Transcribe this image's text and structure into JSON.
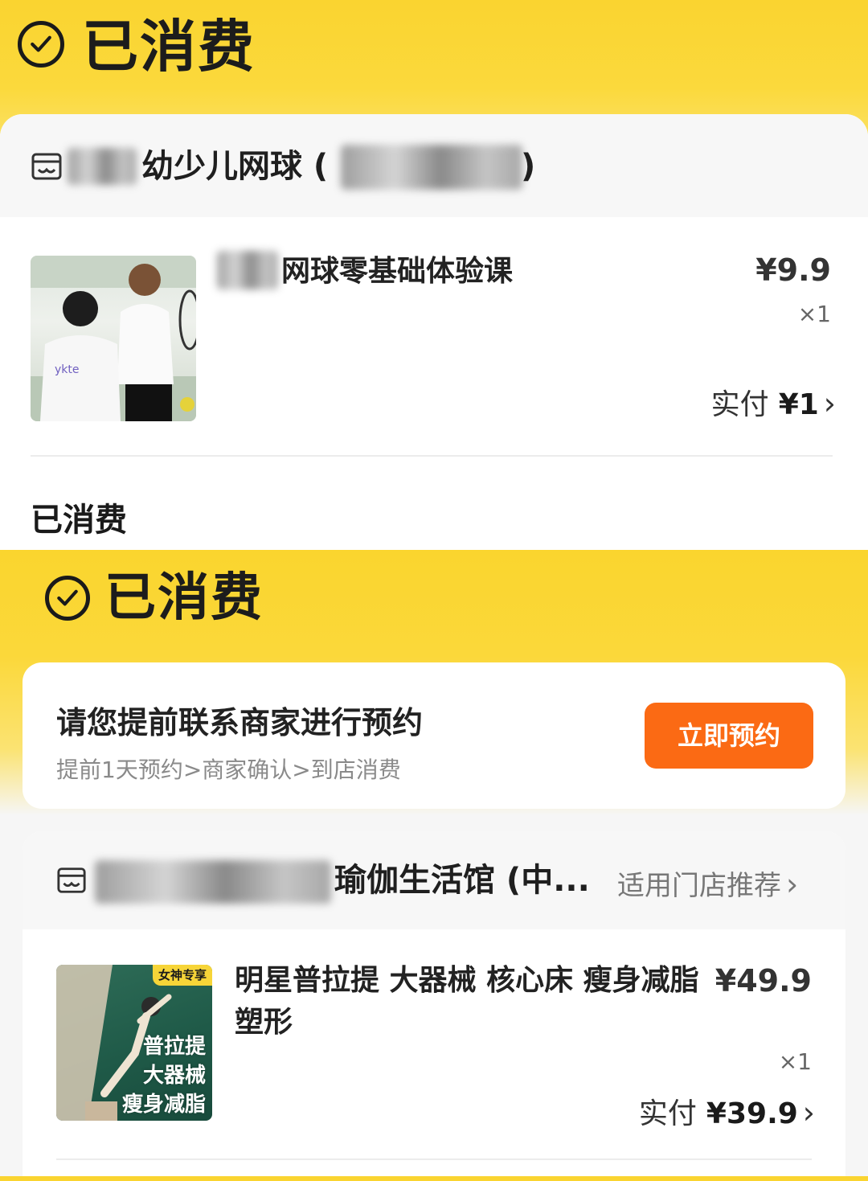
{
  "section1": {
    "status_title": "已消费",
    "store_name": "幼少儿网球 (",
    "store_name_close": ")",
    "product": {
      "title": "网球零基础体验课",
      "price": "¥9.9",
      "qty": "×1",
      "paid_label": "实付",
      "paid_amount": "¥1"
    },
    "caption": "已消费"
  },
  "section2": {
    "status_title": "已消费",
    "reserve": {
      "title": "请您提前联系商家进行预约",
      "subtitle": "提前1天预约>商家确认>到店消费",
      "button": "立即预约"
    },
    "store_name": "瑜伽生活馆 (中...",
    "store_recommend": "适用门店推荐",
    "product": {
      "title_line1": "明星普拉提 大器械 核心床 瘦身减脂",
      "title_line2": "塑形",
      "price": "¥49.9",
      "qty": "×1",
      "paid_label": "实付",
      "paid_amount": "¥39.9",
      "thumb_tag": "女神专享",
      "thumb_lines": [
        "普拉提",
        "大器械",
        "瘦身减脂"
      ]
    }
  },
  "colors": {
    "banner_yellow": "#fad430",
    "reserve_button": "#fb6a14",
    "tag_yellow": "#f7d538",
    "thumb_green": "#1f5a48"
  },
  "icons": [
    "check-circle-icon",
    "store-icon",
    "chevron-right-icon"
  ]
}
